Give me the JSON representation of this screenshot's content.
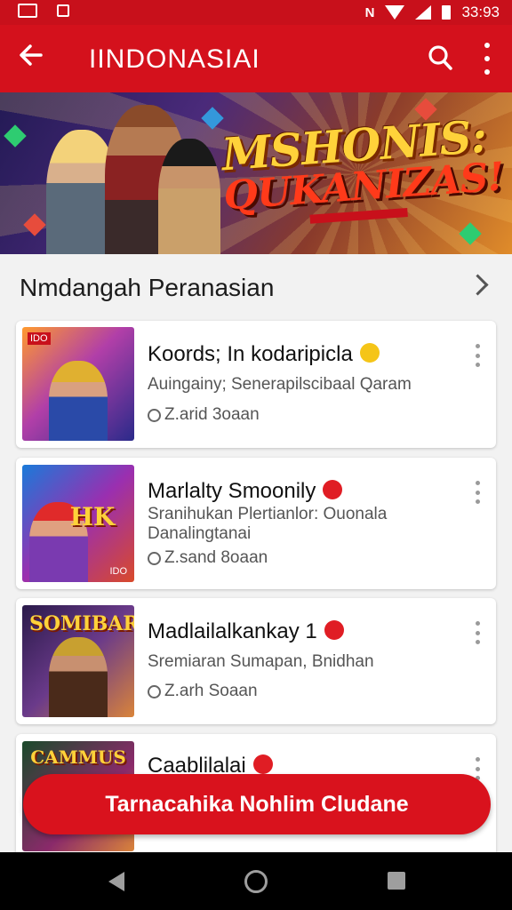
{
  "status_bar": {
    "time": "33:93",
    "icons": [
      "gallery-icon",
      "notification-icon",
      "nfc-icon",
      "wifi-icon",
      "signal-icon",
      "battery-icon"
    ]
  },
  "app_bar": {
    "title": "IINDONASIAI",
    "back_icon": "arrow-left-icon",
    "search_icon": "search-icon",
    "menu_icon": "more-vert-icon",
    "color": "#d4111c"
  },
  "banner": {
    "title_line1": "MSHONIS:",
    "title_line2": "QUKANIZAS!"
  },
  "section": {
    "title": "Nmdangah Peranasian"
  },
  "games": [
    {
      "title": "Koords; In kodaripicla",
      "subtitle": "Auingainy; Senerapilscibaal Qaram",
      "meta": "Z.arid 3oaan",
      "badge_color": "#f5c518",
      "thumb_label": "",
      "thumb_corner": "IDO"
    },
    {
      "title": "Marlalty Smoonily",
      "subtitle": "Sranihukan Plertianlor: Ouonala Danalingtanai",
      "meta": "Z.sand 8oaan",
      "badge_color": "#e01d24",
      "thumb_label": "HK",
      "thumb_corner": "IDO"
    },
    {
      "title": "Madlailalkankay 1",
      "subtitle": "Sremiaran Sumapan, Bnidhan",
      "meta": "Z.arh Soaan",
      "badge_color": "#e01d24",
      "thumb_label": "SOMIBAR",
      "thumb_corner": ""
    },
    {
      "title": "Caablilalai",
      "subtitle": "",
      "meta": "",
      "badge_color": "#e01d24",
      "thumb_label": "CAMMUS",
      "thumb_corner": ""
    }
  ],
  "cta": {
    "label": "Tarnacahika Nohlim Cludane",
    "color": "#d9121d"
  },
  "nav_bar": {
    "icons": [
      "nav-back-icon",
      "nav-home-icon",
      "nav-recents-icon"
    ]
  }
}
